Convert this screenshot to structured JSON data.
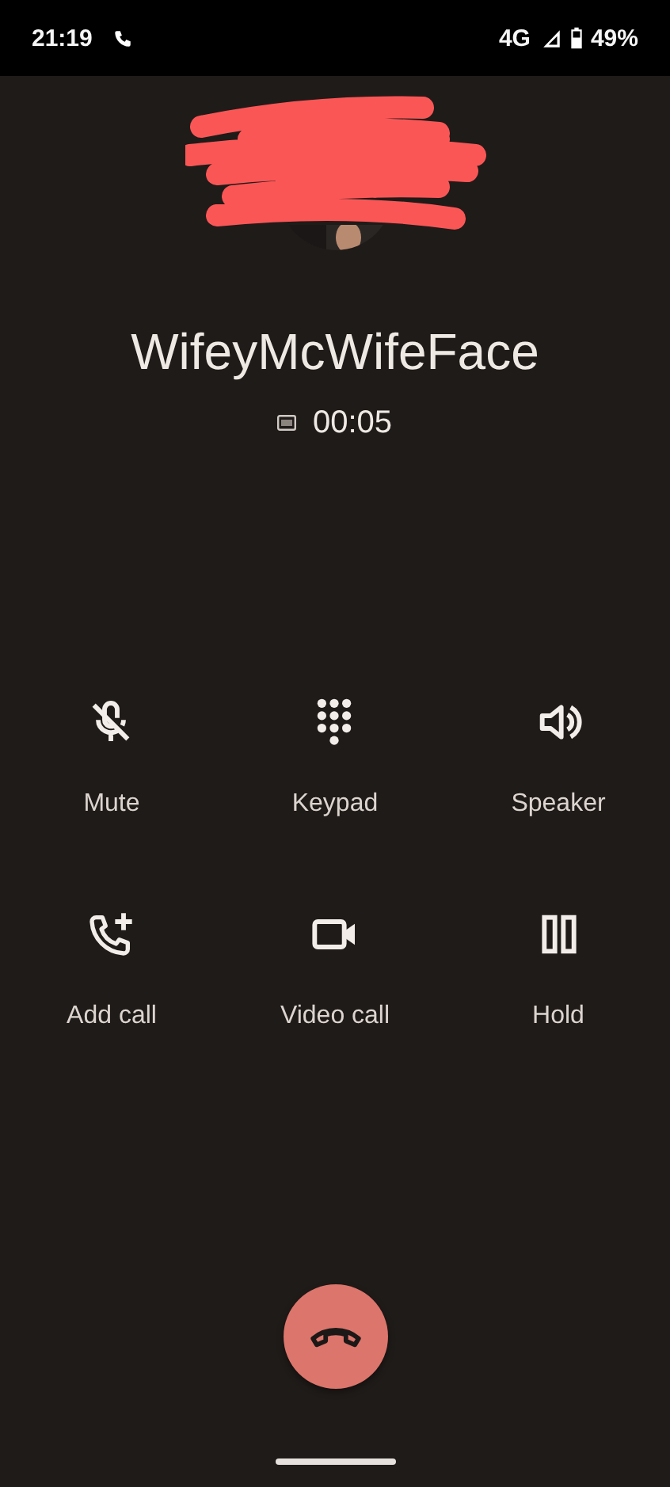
{
  "status_bar": {
    "time": "21:19",
    "network": "4G",
    "battery": "49%"
  },
  "call": {
    "contact_name": "WifeyMcWifeFace",
    "duration": "00:05"
  },
  "controls": [
    {
      "label": "Mute"
    },
    {
      "label": "Keypad"
    },
    {
      "label": "Speaker"
    },
    {
      "label": "Add call"
    },
    {
      "label": "Video call"
    },
    {
      "label": "Hold"
    }
  ]
}
